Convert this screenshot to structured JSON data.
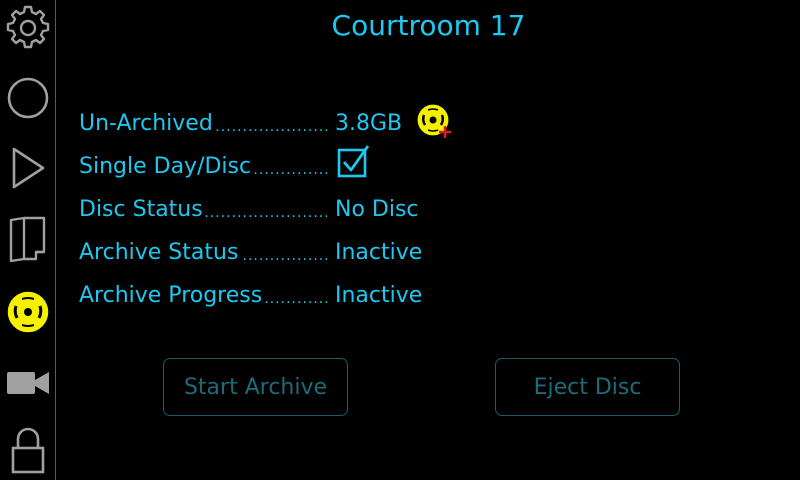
{
  "header": {
    "title": "Courtroom 17"
  },
  "sidebar": {
    "items": [
      {
        "icon": "gear-icon"
      },
      {
        "icon": "circle-icon"
      },
      {
        "icon": "play-icon"
      },
      {
        "icon": "folder-icon"
      },
      {
        "icon": "disc-icon",
        "active": true
      },
      {
        "icon": "video-camera-icon"
      },
      {
        "icon": "lock-icon"
      }
    ]
  },
  "status": {
    "unarchived": {
      "label": "Un-Archived",
      "value": "3.8GB"
    },
    "single_day_disc": {
      "label": "Single Day/Disc",
      "checked": true
    },
    "disc_status": {
      "label": "Disc Status",
      "value": "No Disc"
    },
    "archive_status": {
      "label": "Archive Status",
      "value": "Inactive"
    },
    "archive_progress": {
      "label": "Archive Progress",
      "value": "Inactive"
    }
  },
  "buttons": {
    "start_archive": "Start Archive",
    "eject_disc": "Eject Disc"
  },
  "colors": {
    "accent": "#1ec8f0",
    "disabled": "#1e6a78",
    "disc": "#f5f000",
    "sidebar_icon": "#a0a0a0",
    "add_badge": "#e01818"
  }
}
